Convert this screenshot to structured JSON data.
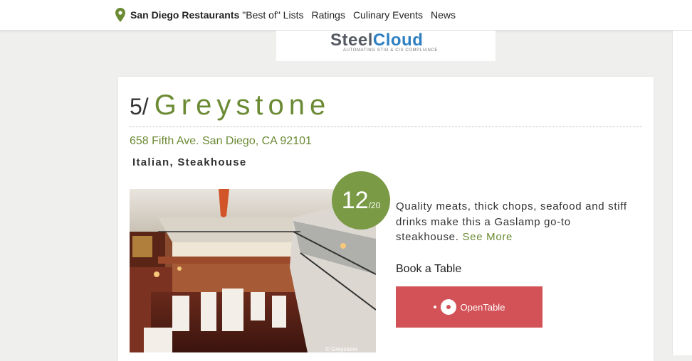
{
  "nav": {
    "brand": "San Diego Restaurants",
    "links": [
      "\"Best of\" Lists",
      "Ratings",
      "Culinary Events",
      "News"
    ],
    "icon": "map-pin-icon",
    "accent": "#6b8a34"
  },
  "ad": {
    "logo_part1": "Steel",
    "logo_part2": "Cloud",
    "tagline": "AUTOMATING STIG & CIS COMPLIANCE"
  },
  "restaurant": {
    "rank": "5/",
    "name": "Greystone",
    "address": "658 Fifth Ave. San Diego, CA 92101",
    "cuisine": "Italian, Steakhouse",
    "score": "12",
    "score_out_of": "/20",
    "description": "Quality meats, thick chops, seafood and stiff drinks make this a Gaslamp go-to steakhouse.",
    "see_more": "See More",
    "photo_credit": "© Greystone",
    "score_color": "#7a9a45"
  },
  "booking": {
    "heading": "Book a Table",
    "button_label": "OpenTable",
    "button_color": "#d35257"
  }
}
